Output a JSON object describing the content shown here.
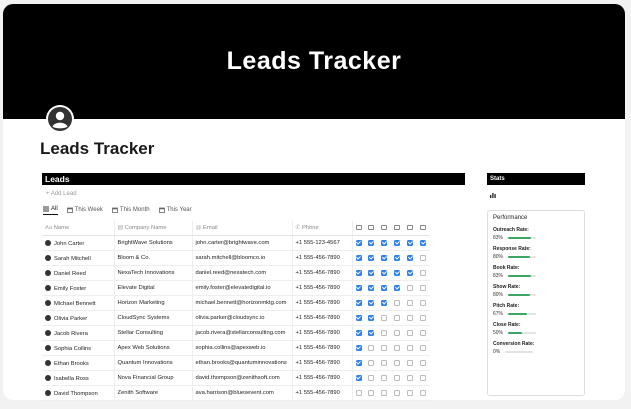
{
  "cover": {
    "title": "Leads Tracker"
  },
  "page": {
    "title": "Leads Tracker"
  },
  "leads": {
    "section_title": "Leads",
    "add_label": "+ Add Lead",
    "tabs": [
      "All",
      "This Week",
      "This Month",
      "This Year"
    ],
    "columns": {
      "name": "Name",
      "company": "Company Name",
      "email": "Email",
      "phone": "Phone"
    },
    "rows": [
      {
        "name": "John Carter",
        "company": "BrightWave Solutions",
        "email": "john.carter@brightwave.com",
        "phone": "+1 555-123-4567",
        "checks": [
          1,
          1,
          1,
          1,
          1,
          1
        ]
      },
      {
        "name": "Sarah Mitchell",
        "company": "Bloom & Co.",
        "email": "sarah.mitchell@bloomco.io",
        "phone": "+1 555-456-7890",
        "checks": [
          1,
          1,
          1,
          1,
          1,
          0
        ]
      },
      {
        "name": "Daniel Reed",
        "company": "NexaTech Innovations",
        "email": "daniel.reed@nexatech.com",
        "phone": "+1 555-456-7890",
        "checks": [
          1,
          1,
          1,
          1,
          1,
          0
        ]
      },
      {
        "name": "Emily Foster",
        "company": "Elevate Digital",
        "email": "emily.foster@elevatedigital.io",
        "phone": "+1 555-456-7890",
        "checks": [
          1,
          1,
          1,
          1,
          0,
          0
        ]
      },
      {
        "name": "Michael Bennett",
        "company": "Horizon Marketing",
        "email": "michael.bennett@horizonmktg.com",
        "phone": "+1 555-456-7890",
        "checks": [
          1,
          1,
          1,
          0,
          0,
          0
        ]
      },
      {
        "name": "Olivia Parker",
        "company": "CloudSync Systems",
        "email": "olivia.parker@cloudsync.io",
        "phone": "+1 555-456-7890",
        "checks": [
          1,
          1,
          0,
          0,
          0,
          0
        ]
      },
      {
        "name": "Jacob Rivera",
        "company": "Stellar Consulting",
        "email": "jacob.rivera@stellarconsulting.com",
        "phone": "+1 555-456-7890",
        "checks": [
          1,
          1,
          0,
          0,
          0,
          0
        ]
      },
      {
        "name": "Sophia Collins",
        "company": "Apex Web Solutions",
        "email": "sophia.collins@apexweb.io",
        "phone": "+1 555-456-7890",
        "checks": [
          1,
          0,
          0,
          0,
          0,
          0
        ]
      },
      {
        "name": "Ethan Brooks",
        "company": "Quantum Innovations",
        "email": "ethan.brooks@quantuminnovations",
        "phone": "+1 555-456-7890",
        "checks": [
          1,
          0,
          0,
          0,
          0,
          0
        ]
      },
      {
        "name": "Isabella Ross",
        "company": "Nova Financial Group",
        "email": "david.thompson@zenithsoft.com",
        "phone": "+1 555-456-7890",
        "checks": [
          1,
          0,
          0,
          0,
          0,
          0
        ]
      },
      {
        "name": "David Thompson",
        "company": "Zenith Software",
        "email": "ava.harrison@bluesevent.com",
        "phone": "+1 555-456-7890",
        "checks": [
          0,
          0,
          0,
          0,
          0,
          0
        ]
      }
    ]
  },
  "stats": {
    "title": "Stats",
    "performance_title": "Performance",
    "metrics": [
      {
        "name": "Outreach Rate:",
        "value": "83%",
        "fraction": 0.83
      },
      {
        "name": "Response Rate:",
        "value": "80%",
        "fraction": 0.8
      },
      {
        "name": "Book Rate:",
        "value": "83%",
        "fraction": 0.83
      },
      {
        "name": "Show Rate:",
        "value": "80%",
        "fraction": 0.8
      },
      {
        "name": "Pitch Rate:",
        "value": "67%",
        "fraction": 0.67
      },
      {
        "name": "Close Rate:",
        "value": "50%",
        "fraction": 0.5
      },
      {
        "name": "Conversion Rate:",
        "value": "0%",
        "fraction": 0.0
      }
    ]
  },
  "colors": {
    "accent": "#2f80ed",
    "progress": "#3aa564",
    "cover": "#000000"
  }
}
